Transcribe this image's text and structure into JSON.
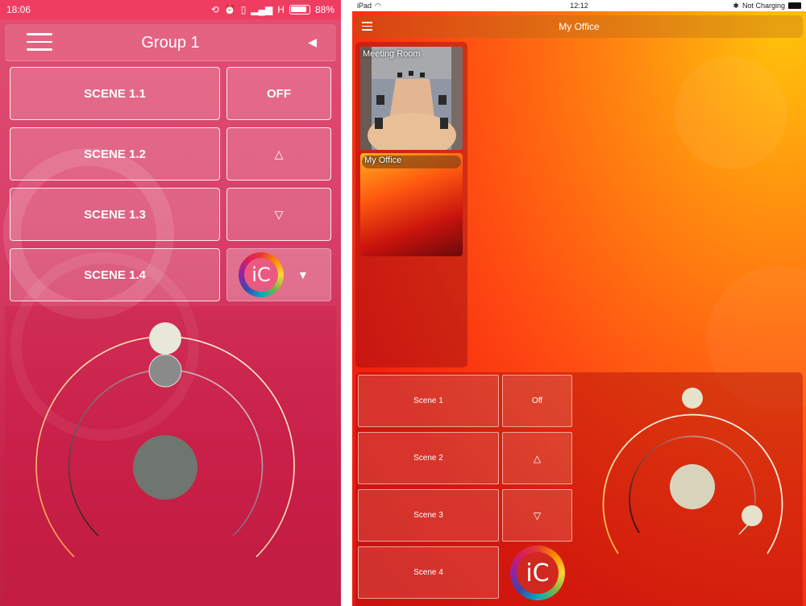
{
  "phone": {
    "status": {
      "time": "18:06",
      "network": "H",
      "battery": "88%"
    },
    "header": {
      "title": "Group 1"
    },
    "scenes": [
      {
        "label": "SCENE 1.1"
      },
      {
        "label": "SCENE 1.2"
      },
      {
        "label": "SCENE 1.3"
      },
      {
        "label": "SCENE 1.4"
      }
    ],
    "controls": {
      "off_label": "OFF",
      "up_symbol": "△",
      "down_symbol": "▽",
      "dropdown_symbol": "▼",
      "back_symbol": "◀"
    },
    "logo_text": "iC",
    "dimmer": {
      "ring_level": 0.5,
      "color_handle": "#e8e8d8",
      "level_handle": "#8a8a8a",
      "center": "#6f766f"
    }
  },
  "tablet": {
    "status": {
      "device": "iPad",
      "time": "12:12",
      "charging": "Not Charging"
    },
    "header": {
      "title": "My Office"
    },
    "rooms": [
      {
        "label": "Meeting Room"
      },
      {
        "label": "My Office"
      }
    ],
    "scenes": [
      {
        "label": "Scene 1"
      },
      {
        "label": "Scene 2"
      },
      {
        "label": "Scene 3"
      },
      {
        "label": "Scene 4"
      }
    ],
    "controls": {
      "off_label": "Off",
      "up_symbol": "△",
      "down_symbol": "▽"
    },
    "logo_text": "iC",
    "dimmer": {
      "handle": "#e6e2cc",
      "center": "#d8d4bc"
    }
  },
  "colors": {
    "phone_bg": "#d9416a",
    "phone_status": "#ef3d62",
    "tablet_accent": "#ff4a12"
  }
}
